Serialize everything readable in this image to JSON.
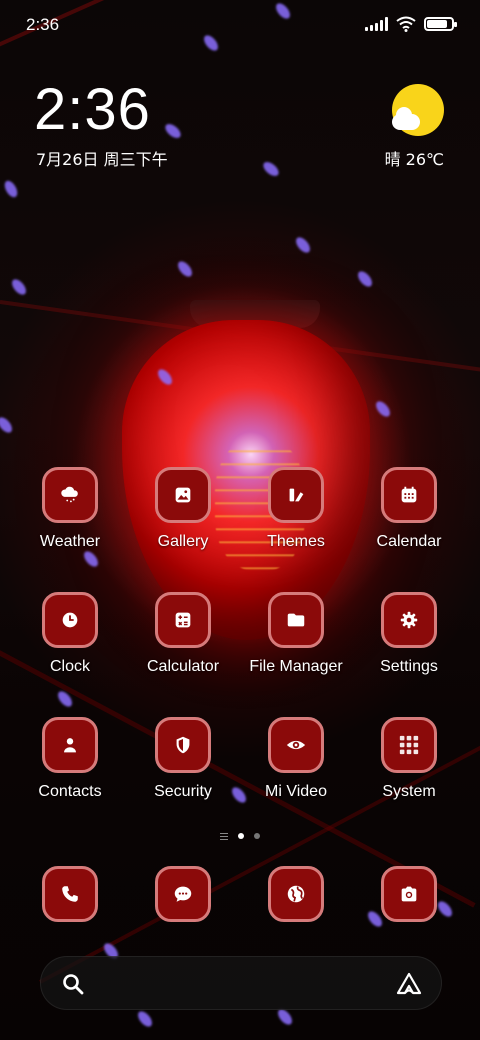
{
  "status_bar": {
    "time": "2:36",
    "battery_level": 0.85
  },
  "widget": {
    "clock": "2:36",
    "date": "7月26日 周三下午",
    "weather": "晴 26℃",
    "weather_icon": "sun-cloud-icon"
  },
  "apps": [
    {
      "label": "Weather",
      "icon": "cloud-rain-icon"
    },
    {
      "label": "Gallery",
      "icon": "image-icon"
    },
    {
      "label": "Themes",
      "icon": "brush-icon"
    },
    {
      "label": "Calendar",
      "icon": "calendar-icon"
    },
    {
      "label": "Clock",
      "icon": "clock-icon"
    },
    {
      "label": "Calculator",
      "icon": "calculator-icon"
    },
    {
      "label": "File Manager",
      "icon": "folder-icon"
    },
    {
      "label": "Settings",
      "icon": "gear-icon"
    },
    {
      "label": "Contacts",
      "icon": "person-icon"
    },
    {
      "label": "Security",
      "icon": "shield-icon"
    },
    {
      "label": "Mi Video",
      "icon": "eye-icon"
    },
    {
      "label": "System",
      "icon": "folder-grid-icon"
    }
  ],
  "pager": {
    "pages": 2,
    "active": 1
  },
  "dock": [
    {
      "icon": "phone-icon"
    },
    {
      "icon": "message-icon"
    },
    {
      "icon": "globe-icon"
    },
    {
      "icon": "camera-icon"
    }
  ],
  "search": {
    "icon": "search-icon",
    "assistant_icon": "assistant-icon"
  },
  "colors": {
    "icon_fill": "#8b0a0a",
    "icon_border": "#d67b7b",
    "sun": "#f9d41a"
  }
}
